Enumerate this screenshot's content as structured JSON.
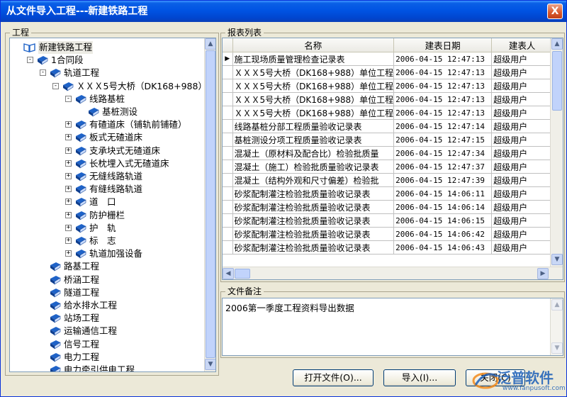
{
  "window": {
    "title": "从文件导入工程---新建铁路工程",
    "close_label": "X"
  },
  "left_panel": {
    "label": "工程"
  },
  "tree": [
    {
      "text": "新建铁路工程",
      "level": 0,
      "expander": "",
      "icon": "open-book"
    },
    {
      "text": "1合同段",
      "level": 1,
      "expander": "-",
      "icon": "book"
    },
    {
      "text": "轨道工程",
      "level": 2,
      "expander": "-",
      "icon": "book"
    },
    {
      "text": "ＸＸＸ5号大桥（DK168+988）",
      "level": 3,
      "expander": "-",
      "icon": "book"
    },
    {
      "text": "线路基桩",
      "level": 4,
      "expander": "-",
      "icon": "book"
    },
    {
      "text": "基桩测设",
      "level": 5,
      "expander": "",
      "icon": "book"
    },
    {
      "text": "有碴道床（铺轨前铺碴）",
      "level": 4,
      "expander": "+",
      "icon": "book"
    },
    {
      "text": "板式无碴道床",
      "level": 4,
      "expander": "+",
      "icon": "book"
    },
    {
      "text": "支承块式无碴道床",
      "level": 4,
      "expander": "+",
      "icon": "book"
    },
    {
      "text": "长枕埋入式无碴道床",
      "level": 4,
      "expander": "+",
      "icon": "book"
    },
    {
      "text": "无缝线路轨道",
      "level": 4,
      "expander": "+",
      "icon": "book"
    },
    {
      "text": "有缝线路轨道",
      "level": 4,
      "expander": "+",
      "icon": "book"
    },
    {
      "text": "道　口",
      "level": 4,
      "expander": "+",
      "icon": "book"
    },
    {
      "text": "防护栅栏",
      "level": 4,
      "expander": "+",
      "icon": "book"
    },
    {
      "text": "护　轨",
      "level": 4,
      "expander": "+",
      "icon": "book"
    },
    {
      "text": "标　志",
      "level": 4,
      "expander": "+",
      "icon": "book"
    },
    {
      "text": "轨道加强设备",
      "level": 4,
      "expander": "+",
      "icon": "book"
    },
    {
      "text": "路基工程",
      "level": 2,
      "expander": "",
      "icon": "book"
    },
    {
      "text": "桥涵工程",
      "level": 2,
      "expander": "",
      "icon": "book"
    },
    {
      "text": "隧道工程",
      "level": 2,
      "expander": "",
      "icon": "book"
    },
    {
      "text": "给水排水工程",
      "level": 2,
      "expander": "",
      "icon": "book"
    },
    {
      "text": "站场工程",
      "level": 2,
      "expander": "",
      "icon": "book"
    },
    {
      "text": "运输通信工程",
      "level": 2,
      "expander": "",
      "icon": "book"
    },
    {
      "text": "信号工程",
      "level": 2,
      "expander": "",
      "icon": "book"
    },
    {
      "text": "电力工程",
      "level": 2,
      "expander": "",
      "icon": "book"
    },
    {
      "text": "电力牵引供电工程",
      "level": 2,
      "expander": "",
      "icon": "book"
    }
  ],
  "report_panel": {
    "label": "报表列表",
    "columns": [
      "名称",
      "建表日期",
      "建表人"
    ],
    "current_row_marker": "▶",
    "rows": [
      [
        "施工现场质量管理检查记录表",
        "2006-04-15 12:47:13",
        "超级用户"
      ],
      [
        "ＸＸＸ5号大桥（DK168+988）单位工程",
        "2006-04-15 12:47:13",
        "超级用户"
      ],
      [
        "ＸＸＸ5号大桥（DK168+988）单位工程",
        "2006-04-15 12:47:13",
        "超级用户"
      ],
      [
        "ＸＸＸ5号大桥（DK168+988）单位工程",
        "2006-04-15 12:47:13",
        "超级用户"
      ],
      [
        "ＸＸＸ5号大桥（DK168+988）单位工程",
        "2006-04-15 12:47:13",
        "超级用户"
      ],
      [
        "线路基桩分部工程质量验收记录表",
        "2006-04-15 12:47:14",
        "超级用户"
      ],
      [
        "基桩测设分项工程质量验收记录表",
        "2006-04-15 12:47:15",
        "超级用户"
      ],
      [
        "混凝土（原材料及配合比）检验批质量",
        "2006-04-15 12:47:34",
        "超级用户"
      ],
      [
        "混凝土（施工）检验批质量验收记录表",
        "2006-04-15 12:47:37",
        "超级用户"
      ],
      [
        "混凝土（结构外观和尺寸偏差）检验批",
        "2006-04-15 12:47:39",
        "超级用户"
      ],
      [
        "砂浆配制灌注检验批质量验收记录表",
        "2006-04-15 14:06:11",
        "超级用户"
      ],
      [
        "砂浆配制灌注检验批质量验收记录表",
        "2006-04-15 14:06:14",
        "超级用户"
      ],
      [
        "砂浆配制灌注检验批质量验收记录表",
        "2006-04-15 14:06:15",
        "超级用户"
      ],
      [
        "砂浆配制灌注检验批质量验收记录表",
        "2006-04-15 14:06:42",
        "超级用户"
      ],
      [
        "砂浆配制灌注检验批质量验收记录表",
        "2006-04-15 14:06:43",
        "超级用户"
      ]
    ]
  },
  "notes_panel": {
    "label": "文件备注",
    "text": "2006第一季度工程资料导出数据"
  },
  "buttons": {
    "open_file": "打开文件(O)...",
    "import": "导入(I)...",
    "close": "关闭(C)"
  },
  "brand": {
    "name": "泛普软件",
    "url": "www.fanpusoft.com"
  },
  "colors": {
    "titlebar": "#0054e3",
    "book_icon": "#1f63c8",
    "close_button": "#d9572a",
    "brand": "#1c5fb8"
  }
}
